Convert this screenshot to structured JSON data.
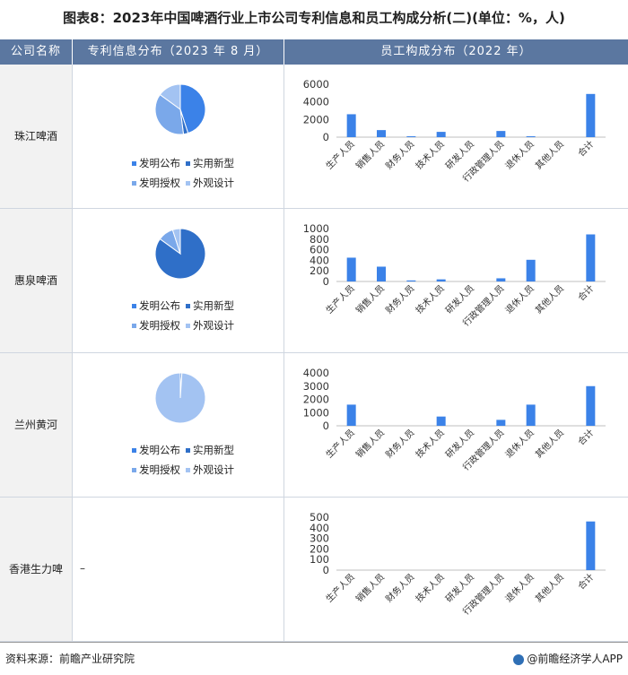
{
  "title": "图表8：2023年中国啤酒行业上市公司专利信息和员工构成分析(二)(单位：%，人)",
  "header": {
    "company": "公司名称",
    "patent": "专利信息分布（2023 年 8 月）",
    "employee": "员工构成分布（2022 年）"
  },
  "legend": [
    "发明公布",
    "实用新型",
    "发明授权",
    "外观设计"
  ],
  "colors": {
    "bar": "#3b82e8",
    "pie": [
      "#3b82e8",
      "#2f6fc8",
      "#7aa8ea",
      "#a3c3f2"
    ],
    "header_bg": "#5b77a0"
  },
  "rows": [
    {
      "company": "珠江啤酒",
      "patent_dash": ""
    },
    {
      "company": "惠泉啤酒",
      "patent_dash": ""
    },
    {
      "company": "兰州黄河",
      "patent_dash": ""
    },
    {
      "company": "香港生力啤",
      "patent_dash": "–"
    }
  ],
  "footer": {
    "source": "资料来源：前瞻产业研究院",
    "brand": "@前瞻经济学人APP"
  },
  "chart_data": [
    {
      "type": "pie",
      "company": "珠江啤酒",
      "categories": [
        "发明公布",
        "实用新型",
        "发明授权",
        "外观设计"
      ],
      "values": [
        45,
        3,
        37,
        15
      ]
    },
    {
      "type": "bar",
      "company": "珠江啤酒",
      "categories": [
        "生产人员",
        "销售人员",
        "财务人员",
        "技术人员",
        "研发人员",
        "行政管理人员",
        "退休人员",
        "其他人员",
        "合计"
      ],
      "values": [
        2600,
        800,
        100,
        600,
        0,
        700,
        100,
        0,
        4900
      ],
      "ylim": [
        0,
        6000
      ],
      "yticks": [
        0,
        2000,
        4000,
        6000
      ]
    },
    {
      "type": "pie",
      "company": "惠泉啤酒",
      "categories": [
        "发明公布",
        "实用新型",
        "发明授权",
        "外观设计"
      ],
      "values": [
        0,
        85,
        10,
        5
      ]
    },
    {
      "type": "bar",
      "company": "惠泉啤酒",
      "categories": [
        "生产人员",
        "销售人员",
        "财务人员",
        "技术人员",
        "研发人员",
        "行政管理人员",
        "退休人员",
        "其他人员",
        "合计"
      ],
      "values": [
        450,
        280,
        20,
        40,
        0,
        60,
        410,
        0,
        890
      ],
      "ylim": [
        0,
        1000
      ],
      "yticks": [
        0,
        200,
        400,
        600,
        800,
        1000
      ]
    },
    {
      "type": "pie",
      "company": "兰州黄河",
      "categories": [
        "发明公布",
        "实用新型",
        "发明授权",
        "外观设计"
      ],
      "values": [
        0,
        1,
        0,
        99
      ]
    },
    {
      "type": "bar",
      "company": "兰州黄河",
      "categories": [
        "生产人员",
        "销售人员",
        "财务人员",
        "技术人员",
        "研发人员",
        "行政管理人员",
        "退休人员",
        "其他人员",
        "合计"
      ],
      "values": [
        1600,
        0,
        0,
        700,
        0,
        450,
        1600,
        0,
        3000
      ],
      "ylim": [
        0,
        4000
      ],
      "yticks": [
        0,
        1000,
        2000,
        3000,
        4000
      ]
    },
    {
      "type": "bar",
      "company": "香港生力啤",
      "categories": [
        "生产人员",
        "销售人员",
        "财务人员",
        "技术人员",
        "研发人员",
        "行政管理人员",
        "退休人员",
        "其他人员",
        "合计"
      ],
      "values": [
        0,
        0,
        0,
        0,
        0,
        0,
        0,
        0,
        460
      ],
      "ylim": [
        0,
        500
      ],
      "yticks": [
        0,
        100,
        200,
        300,
        400,
        500
      ]
    }
  ]
}
